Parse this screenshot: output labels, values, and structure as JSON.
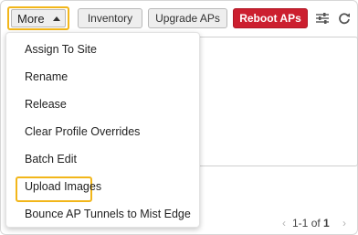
{
  "toolbar": {
    "more_label": "More",
    "inventory_label": "Inventory",
    "upgrade_label": "Upgrade APs",
    "reboot_label": "Reboot APs",
    "reboot_color": "#cc1f2f",
    "highlight_color": "#f2b61a",
    "settings_icon": "sliders-icon",
    "refresh_icon": "refresh-icon"
  },
  "menu": {
    "items": [
      {
        "label": "Assign To Site"
      },
      {
        "label": "Rename"
      },
      {
        "label": "Release"
      },
      {
        "label": "Clear Profile Overrides"
      },
      {
        "label": "Batch Edit",
        "highlighted": true
      },
      {
        "label": "Upload Images"
      },
      {
        "label": "Bounce AP Tunnels to Mist Edge"
      }
    ]
  },
  "pagination": {
    "range": "1-1",
    "of_label": "of",
    "total": "1"
  }
}
